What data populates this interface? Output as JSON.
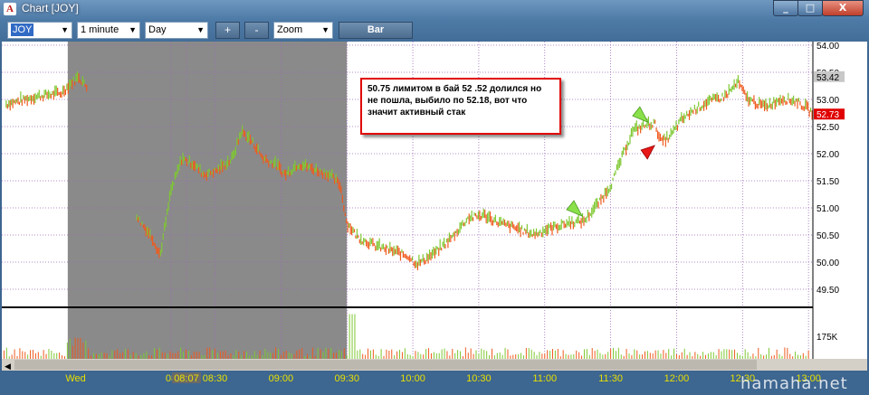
{
  "window": {
    "title": "Chart [JOY]",
    "app_icon": "A"
  },
  "controls": {
    "minimize": "_",
    "maximize": "□",
    "close": "X"
  },
  "toolbar": {
    "symbol": "JOY",
    "interval": "1 minute",
    "period": "Day",
    "zoom_in": "+",
    "zoom_out": "-",
    "zoom": "Zoom",
    "chart_type": "Bar"
  },
  "annotation": {
    "text": "50.75 лимитом в бай 52 .52 долился но не пошла, выбило по 52.18, вот что значит активный стак"
  },
  "watermark": "hamaha.net",
  "chart_data": {
    "type": "bar",
    "symbol": "JOY",
    "interval": "1 minute",
    "ylim": [
      49.2,
      54.0
    ],
    "y_ticks": [
      "54.00",
      "53.50",
      "53.00",
      "52.50",
      "52.00",
      "51.50",
      "51.00",
      "50.50",
      "50.00",
      "49.50"
    ],
    "price_marks": [
      {
        "label": "53.42",
        "value": 53.42,
        "color": "#c8c8c8"
      },
      {
        "label": "52.73",
        "value": 52.73,
        "color": "#e00000"
      }
    ],
    "volume_label": "175K",
    "x_ticks": [
      {
        "label": "Wed",
        "t": -130
      },
      {
        "label": "08",
        "t": -80
      },
      {
        "label": "08:07",
        "t": -73
      },
      {
        "label": "08:30",
        "t": -60
      },
      {
        "label": "09:00",
        "t": -30
      },
      {
        "label": "09:30",
        "t": 0
      },
      {
        "label": "10:00",
        "t": 30
      },
      {
        "label": "10:30",
        "t": 60
      },
      {
        "label": "11:00",
        "t": 90
      },
      {
        "label": "11:30",
        "t": 120
      },
      {
        "label": "12:00",
        "t": 150
      },
      {
        "label": "12:30",
        "t": 180
      },
      {
        "label": "13:00",
        "t": 210
      }
    ],
    "t_range": [
      -157,
      212
    ],
    "shaded_range": [
      -127,
      0
    ],
    "price_path": [
      [
        -155,
        52.9
      ],
      [
        -140,
        53.05
      ],
      [
        -130,
        53.1
      ],
      [
        -125,
        53.3
      ],
      [
        -122,
        53.4
      ],
      [
        -118,
        53.2
      ],
      [
        -95,
        50.8
      ],
      [
        -88,
        50.4
      ],
      [
        -85,
        50.1
      ],
      [
        -80,
        51.3
      ],
      [
        -75,
        51.9
      ],
      [
        -70,
        51.8
      ],
      [
        -65,
        51.6
      ],
      [
        -58,
        51.7
      ],
      [
        -52,
        51.9
      ],
      [
        -48,
        52.4
      ],
      [
        -43,
        52.2
      ],
      [
        -38,
        51.9
      ],
      [
        -33,
        51.8
      ],
      [
        -28,
        51.6
      ],
      [
        -22,
        51.8
      ],
      [
        -15,
        51.7
      ],
      [
        -8,
        51.6
      ],
      [
        -3,
        51.4
      ],
      [
        0,
        50.7
      ],
      [
        5,
        50.45
      ],
      [
        12,
        50.3
      ],
      [
        20,
        50.2
      ],
      [
        28,
        50.1
      ],
      [
        32,
        49.95
      ],
      [
        40,
        50.15
      ],
      [
        48,
        50.45
      ],
      [
        55,
        50.8
      ],
      [
        62,
        50.85
      ],
      [
        70,
        50.7
      ],
      [
        78,
        50.6
      ],
      [
        85,
        50.5
      ],
      [
        92,
        50.6
      ],
      [
        100,
        50.7
      ],
      [
        108,
        50.75
      ],
      [
        115,
        51.1
      ],
      [
        120,
        51.4
      ],
      [
        125,
        51.9
      ],
      [
        130,
        52.4
      ],
      [
        136,
        52.52
      ],
      [
        140,
        52.55
      ],
      [
        143,
        52.2
      ],
      [
        147,
        52.3
      ],
      [
        152,
        52.6
      ],
      [
        158,
        52.8
      ],
      [
        165,
        52.95
      ],
      [
        172,
        53.05
      ],
      [
        178,
        53.3
      ],
      [
        182,
        53.0
      ],
      [
        190,
        52.85
      ],
      [
        198,
        53.0
      ],
      [
        205,
        52.95
      ],
      [
        212,
        52.73
      ]
    ],
    "arrows": [
      {
        "color": "green",
        "t": 107,
        "price": 50.85
      },
      {
        "color": "green",
        "t": 137,
        "price": 52.58
      },
      {
        "color": "red",
        "t": 140,
        "price": 52.15
      }
    ]
  }
}
